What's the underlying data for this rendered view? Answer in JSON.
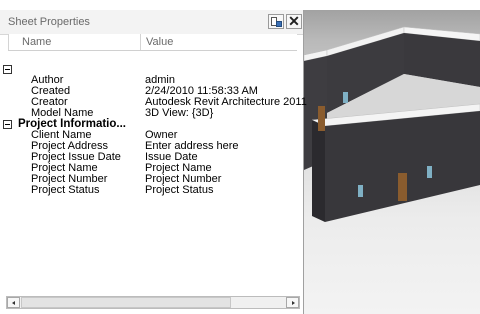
{
  "panel": {
    "title": "Sheet Properties",
    "columns": {
      "name": "Name",
      "value": "Value"
    },
    "groups": [
      {
        "label": "",
        "rows": [
          {
            "name": "Author",
            "value": "admin"
          },
          {
            "name": "Created",
            "value": "2/24/2010 11:58:33 AM"
          },
          {
            "name": "Creator",
            "value": "Autodesk Revit Architecture 2011"
          },
          {
            "name": "Model Name",
            "value": "3D View: {3D}"
          }
        ]
      },
      {
        "label": "Project Informatio...",
        "rows": [
          {
            "name": "Client Name",
            "value": "Owner"
          },
          {
            "name": "Project Address",
            "value": "Enter address here"
          },
          {
            "name": "Project Issue Date",
            "value": "Issue Date"
          },
          {
            "name": "Project Name",
            "value": "Project Name"
          },
          {
            "name": "Project Number",
            "value": "Project Number"
          },
          {
            "name": "Project Status",
            "value": "Project Status"
          }
        ]
      }
    ]
  },
  "icons": {
    "properties_toggle": "properties-icon",
    "close": "close-icon",
    "collapse": "collapse-icon"
  },
  "colors": {
    "wall_top": "#f4f4f4",
    "wall_dark": "#3c3b3f",
    "door": "#8a5c2e",
    "window": "#7fb0c4"
  }
}
